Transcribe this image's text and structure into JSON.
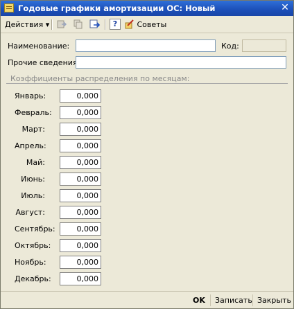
{
  "window": {
    "title": "Годовые графики амортизации ОС: Новый",
    "close_glyph": "✕"
  },
  "toolbar": {
    "actions_label": "Действия",
    "actions_arrow": "▾",
    "help_glyph": "?",
    "tips_label": "Советы",
    "icons": [
      "save-copy-icon",
      "copy-icon",
      "refresh-icon",
      "help-icon",
      "tips-icon"
    ]
  },
  "form": {
    "name_label": "Наименование:",
    "name_value": "",
    "code_label": "Код:",
    "code_value": "",
    "other_label": "Прочие сведения:",
    "other_value": ""
  },
  "group": {
    "title": "Коэффициенты распределения по месяцам:"
  },
  "months": [
    {
      "label": "Январь:",
      "value": "0,000"
    },
    {
      "label": "Февраль:",
      "value": "0,000"
    },
    {
      "label": "Март:",
      "value": "0,000"
    },
    {
      "label": "Апрель:",
      "value": "0,000"
    },
    {
      "label": "Май:",
      "value": "0,000"
    },
    {
      "label": "Июнь:",
      "value": "0,000"
    },
    {
      "label": "Июль:",
      "value": "0,000"
    },
    {
      "label": "Август:",
      "value": "0,000"
    },
    {
      "label": "Сентябрь:",
      "value": "0,000"
    },
    {
      "label": "Октябрь:",
      "value": "0,000"
    },
    {
      "label": "Ноябрь:",
      "value": "0,000"
    },
    {
      "label": "Декабрь:",
      "value": "0,000"
    }
  ],
  "footer": {
    "ok_label": "OK",
    "save_label": "Записать",
    "close_label": "Закрыть"
  }
}
